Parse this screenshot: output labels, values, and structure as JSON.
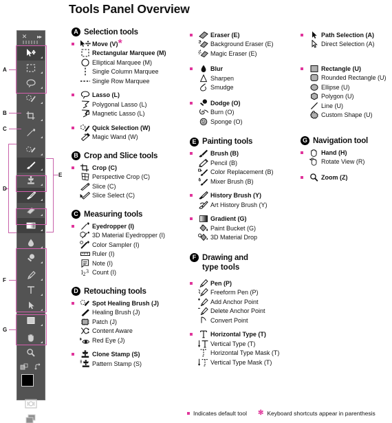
{
  "title": "Tools Panel Overview",
  "toolbar": {
    "close_label": "✕",
    "expand_label": "▸▸",
    "letters": [
      "A",
      "B",
      "C",
      "D",
      "E",
      "F",
      "G"
    ],
    "items": [
      {
        "name": "move-tool",
        "selected": true
      },
      {
        "name": "rectangular-marquee-tool",
        "selected": false
      },
      {
        "name": "lasso-tool",
        "selected": false
      },
      {
        "name": "quick-selection-tool",
        "selected": false
      },
      {
        "name": "crop-tool",
        "selected": false
      },
      {
        "name": "eyedropper-tool",
        "selected": false
      },
      {
        "name": "spot-healing-brush-tool",
        "selected": false
      },
      {
        "name": "brush-tool",
        "selected": true
      },
      {
        "name": "clone-stamp-tool",
        "selected": false
      },
      {
        "name": "history-brush-tool",
        "selected": true
      },
      {
        "name": "eraser-tool",
        "selected": false
      },
      {
        "name": "gradient-tool",
        "selected": true
      },
      {
        "name": "blur-tool",
        "selected": false
      },
      {
        "name": "dodge-tool",
        "selected": false
      },
      {
        "name": "pen-tool",
        "selected": false
      },
      {
        "name": "horizontal-type-tool",
        "selected": false
      },
      {
        "name": "path-selection-tool",
        "selected": false
      },
      {
        "name": "rectangle-tool",
        "selected": false
      },
      {
        "name": "hand-tool",
        "selected": false
      },
      {
        "name": "zoom-tool",
        "selected": false
      }
    ]
  },
  "columns": [
    {
      "sections": [
        {
          "letter": "A",
          "title": "Selection tools",
          "groups": [
            {
              "tools": [
                {
                  "label": "Move (V)",
                  "default": true,
                  "shortcut_star": true,
                  "icon": "move-icon"
                },
                {
                  "label": "Rectangular Marquee (M)",
                  "default": false,
                  "icon": "rectangular-marquee-icon"
                },
                {
                  "label": "Elliptical Marquee (M)",
                  "default": false,
                  "icon": "elliptical-marquee-icon"
                },
                {
                  "label": "Single Column Marquee",
                  "default": false,
                  "icon": "single-column-marquee-icon"
                },
                {
                  "label": "Single Row Marquee",
                  "default": false,
                  "icon": "single-row-marquee-icon"
                }
              ]
            },
            {
              "tools": [
                {
                  "label": "Lasso (L)",
                  "default": true,
                  "icon": "lasso-icon"
                },
                {
                  "label": "Polygonal Lasso (L)",
                  "default": false,
                  "icon": "polygonal-lasso-icon"
                },
                {
                  "label": "Magnetic Lasso (L)",
                  "default": false,
                  "icon": "magnetic-lasso-icon"
                }
              ]
            },
            {
              "tools": [
                {
                  "label": "Quick Selection (W)",
                  "default": true,
                  "icon": "quick-selection-icon"
                },
                {
                  "label": "Magic Wand (W)",
                  "default": false,
                  "icon": "magic-wand-icon"
                }
              ]
            }
          ]
        },
        {
          "letter": "B",
          "title": "Crop and Slice tools",
          "groups": [
            {
              "tools": [
                {
                  "label": "Crop (C)",
                  "default": true,
                  "icon": "crop-icon"
                },
                {
                  "label": "Perspective Crop (C)",
                  "default": false,
                  "icon": "perspective-crop-icon"
                },
                {
                  "label": "Slice (C)",
                  "default": false,
                  "icon": "slice-icon"
                },
                {
                  "label": "Slice Select (C)",
                  "default": false,
                  "icon": "slice-select-icon"
                }
              ]
            }
          ]
        },
        {
          "letter": "C",
          "title": "Measuring tools",
          "groups": [
            {
              "tools": [
                {
                  "label": "Eyedropper (I)",
                  "default": true,
                  "icon": "eyedropper-icon"
                },
                {
                  "label": "3D Material Eyedropper (I)",
                  "default": false,
                  "icon": "3d-material-eyedropper-icon"
                },
                {
                  "label": "Color Sampler (I)",
                  "default": false,
                  "icon": "color-sampler-icon"
                },
                {
                  "label": "Ruler (I)",
                  "default": false,
                  "icon": "ruler-icon"
                },
                {
                  "label": "Note (I)",
                  "default": false,
                  "icon": "note-icon"
                },
                {
                  "label": "Count (I)",
                  "default": false,
                  "icon": "count-icon"
                }
              ]
            }
          ]
        },
        {
          "letter": "D",
          "title": "Retouching tools",
          "groups": [
            {
              "tools": [
                {
                  "label": "Spot Healing Brush (J)",
                  "default": true,
                  "icon": "spot-healing-brush-icon"
                },
                {
                  "label": "Healing Brush (J)",
                  "default": false,
                  "icon": "healing-brush-icon"
                },
                {
                  "label": "Patch (J)",
                  "default": false,
                  "icon": "patch-icon"
                },
                {
                  "label": "Content Aware",
                  "default": false,
                  "icon": "content-aware-icon"
                },
                {
                  "label": "Red Eye (J)",
                  "default": false,
                  "icon": "red-eye-icon"
                }
              ]
            },
            {
              "tools": [
                {
                  "label": "Clone Stamp (S)",
                  "default": true,
                  "icon": "clone-stamp-icon"
                },
                {
                  "label": "Pattern Stamp (S)",
                  "default": false,
                  "icon": "pattern-stamp-icon"
                }
              ]
            }
          ]
        }
      ]
    },
    {
      "sections": [
        {
          "letter": "",
          "title": "",
          "groups": [
            {
              "tools": [
                {
                  "label": "Eraser (E)",
                  "default": true,
                  "icon": "eraser-icon"
                },
                {
                  "label": "Background Eraser (E)",
                  "default": false,
                  "icon": "background-eraser-icon"
                },
                {
                  "label": "Magic Eraser (E)",
                  "default": false,
                  "icon": "magic-eraser-icon"
                }
              ]
            },
            {
              "tools": [
                {
                  "label": "Blur",
                  "default": true,
                  "icon": "blur-icon"
                },
                {
                  "label": "Sharpen",
                  "default": false,
                  "icon": "sharpen-icon"
                },
                {
                  "label": "Smudge",
                  "default": false,
                  "icon": "smudge-icon"
                }
              ]
            },
            {
              "tools": [
                {
                  "label": "Dodge (O)",
                  "default": true,
                  "icon": "dodge-icon"
                },
                {
                  "label": "Burn (O)",
                  "default": false,
                  "icon": "burn-icon"
                },
                {
                  "label": "Sponge (O)",
                  "default": false,
                  "icon": "sponge-icon"
                }
              ]
            }
          ]
        },
        {
          "letter": "E",
          "title": "Painting tools",
          "groups": [
            {
              "tools": [
                {
                  "label": "Brush (B)",
                  "default": true,
                  "icon": "brush-icon"
                },
                {
                  "label": "Pencil (B)",
                  "default": false,
                  "icon": "pencil-icon"
                },
                {
                  "label": "Color Replacement (B)",
                  "default": false,
                  "icon": "color-replacement-icon"
                },
                {
                  "label": "Mixer Brush (B)",
                  "default": false,
                  "icon": "mixer-brush-icon"
                }
              ]
            },
            {
              "tools": [
                {
                  "label": "History Brush (Y)",
                  "default": true,
                  "icon": "history-brush-icon"
                },
                {
                  "label": "Art History Brush (Y)",
                  "default": false,
                  "icon": "art-history-brush-icon"
                }
              ]
            },
            {
              "tools": [
                {
                  "label": "Gradient (G)",
                  "default": true,
                  "icon": "gradient-icon"
                },
                {
                  "label": "Paint Bucket (G)",
                  "default": false,
                  "icon": "paint-bucket-icon"
                },
                {
                  "label": "3D Material Drop",
                  "default": false,
                  "icon": "3d-material-drop-icon"
                }
              ]
            }
          ]
        },
        {
          "letter": "F",
          "title": "Drawing and",
          "title2": "type tools",
          "groups": [
            {
              "tools": [
                {
                  "label": "Pen (P)",
                  "default": true,
                  "icon": "pen-icon"
                },
                {
                  "label": "Freeform Pen (P)",
                  "default": false,
                  "icon": "freeform-pen-icon"
                },
                {
                  "label": "Add Anchor Point",
                  "default": false,
                  "icon": "add-anchor-point-icon"
                },
                {
                  "label": "Delete Anchor Point",
                  "default": false,
                  "icon": "delete-anchor-point-icon"
                },
                {
                  "label": "Convert Point",
                  "default": false,
                  "icon": "convert-point-icon"
                }
              ]
            },
            {
              "tools": [
                {
                  "label": "Horizontal Type (T)",
                  "default": true,
                  "icon": "horizontal-type-icon"
                },
                {
                  "label": "Vertical Type (T)",
                  "default": false,
                  "icon": "vertical-type-icon"
                },
                {
                  "label": "Horizontal Type Mask (T)",
                  "default": false,
                  "icon": "horizontal-type-mask-icon"
                },
                {
                  "label": "Vertical Type Mask (T)",
                  "default": false,
                  "icon": "vertical-type-mask-icon"
                }
              ]
            }
          ]
        }
      ]
    },
    {
      "sections": [
        {
          "letter": "",
          "title": "",
          "groups": [
            {
              "tools": [
                {
                  "label": "Path Selection (A)",
                  "default": true,
                  "icon": "path-selection-icon"
                },
                {
                  "label": "Direct Selection (A)",
                  "default": false,
                  "icon": "direct-selection-icon"
                }
              ]
            },
            {
              "tools": [
                {
                  "label": "Rectangle (U)",
                  "default": true,
                  "icon": "rectangle-icon"
                },
                {
                  "label": "Rounded Rectangle (U)",
                  "default": false,
                  "icon": "rounded-rectangle-icon"
                },
                {
                  "label": "Ellipse (U)",
                  "default": false,
                  "icon": "ellipse-icon"
                },
                {
                  "label": "Polygon (U)",
                  "default": false,
                  "icon": "polygon-icon"
                },
                {
                  "label": "Line (U)",
                  "default": false,
                  "icon": "line-icon"
                },
                {
                  "label": "Custom Shape (U)",
                  "default": false,
                  "icon": "custom-shape-icon"
                }
              ]
            }
          ]
        },
        {
          "letter": "G",
          "title": "Navigation tool",
          "groups": [
            {
              "tools": [
                {
                  "label": "Hand (H)",
                  "default": true,
                  "icon": "hand-icon"
                },
                {
                  "label": "Rotate View (R)",
                  "default": false,
                  "icon": "rotate-view-icon"
                }
              ]
            },
            {
              "tools": [
                {
                  "label": "Zoom (Z)",
                  "default": true,
                  "icon": "zoom-icon"
                }
              ]
            }
          ]
        }
      ]
    }
  ],
  "legend": {
    "default_text": "Indicates default tool",
    "shortcut_text": "Keyboard shortcuts appear in parenthesis",
    "star": "✻"
  },
  "colors": {
    "accent": "#e0359b",
    "bracket": "#c862aa",
    "box": "#d45fae",
    "panel_bg": "#535353",
    "panel_selected": "#404040",
    "text": "#111111"
  }
}
